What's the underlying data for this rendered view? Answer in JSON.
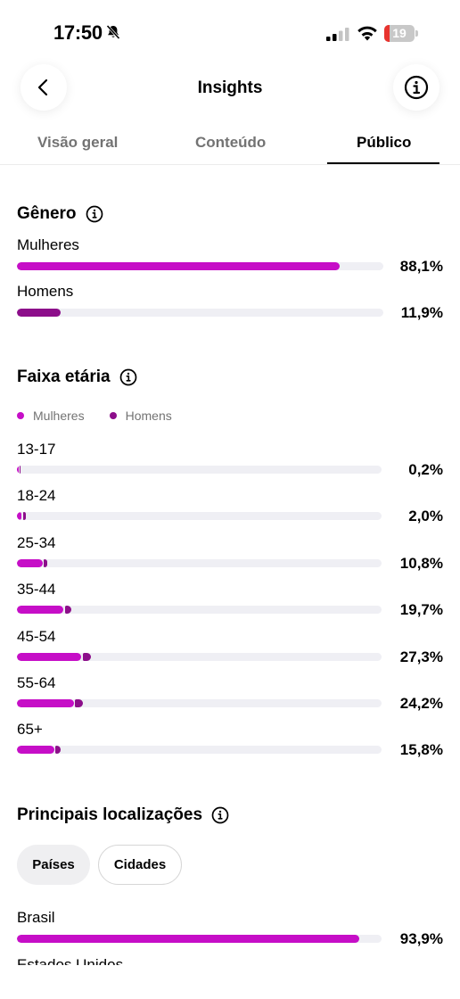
{
  "status_bar": {
    "time": "17:50",
    "battery": "19",
    "battery_level": 0.19,
    "icons": [
      "bell-muted-icon",
      "signal-icon",
      "wifi-icon",
      "battery-icon"
    ]
  },
  "header": {
    "title": "Insights",
    "back_icon": "chevron-left-icon",
    "info_icon": "info-icon"
  },
  "tabs": [
    {
      "label": "Visão geral",
      "active": false
    },
    {
      "label": "Conteúdo",
      "active": false
    },
    {
      "label": "Público",
      "active": true
    }
  ],
  "colors": {
    "women": "#c60ec7",
    "men": "#8c0e8a",
    "track": "#efeff4"
  },
  "gender": {
    "title": "Gênero",
    "rows": [
      {
        "label": "Mulheres",
        "pct": "88,1%",
        "value": 88.1,
        "series": "women"
      },
      {
        "label": "Homens",
        "pct": "11,9%",
        "value": 11.9,
        "series": "men"
      }
    ]
  },
  "age": {
    "title": "Faixa etária",
    "legend": {
      "women": "Mulheres",
      "men": "Homens"
    },
    "rows": [
      {
        "label": "13-17",
        "pct": "0,2%",
        "value": 0.2
      },
      {
        "label": "18-24",
        "pct": "2,0%",
        "value": 2.0
      },
      {
        "label": "25-34",
        "pct": "10,8%",
        "value": 10.8
      },
      {
        "label": "35-44",
        "pct": "19,7%",
        "value": 19.7
      },
      {
        "label": "45-54",
        "pct": "27,3%",
        "value": 27.3
      },
      {
        "label": "55-64",
        "pct": "24,2%",
        "value": 24.2
      },
      {
        "label": "65+",
        "pct": "15,8%",
        "value": 15.8
      }
    ]
  },
  "locations": {
    "title": "Principais localizações",
    "chips": [
      {
        "label": "Países",
        "selected": true
      },
      {
        "label": "Cidades",
        "selected": false
      }
    ],
    "rows": [
      {
        "label": "Brasil",
        "pct": "93,9%",
        "value": 93.9
      },
      {
        "label": "Estados Unidos",
        "pct": "",
        "value": null
      }
    ]
  }
}
